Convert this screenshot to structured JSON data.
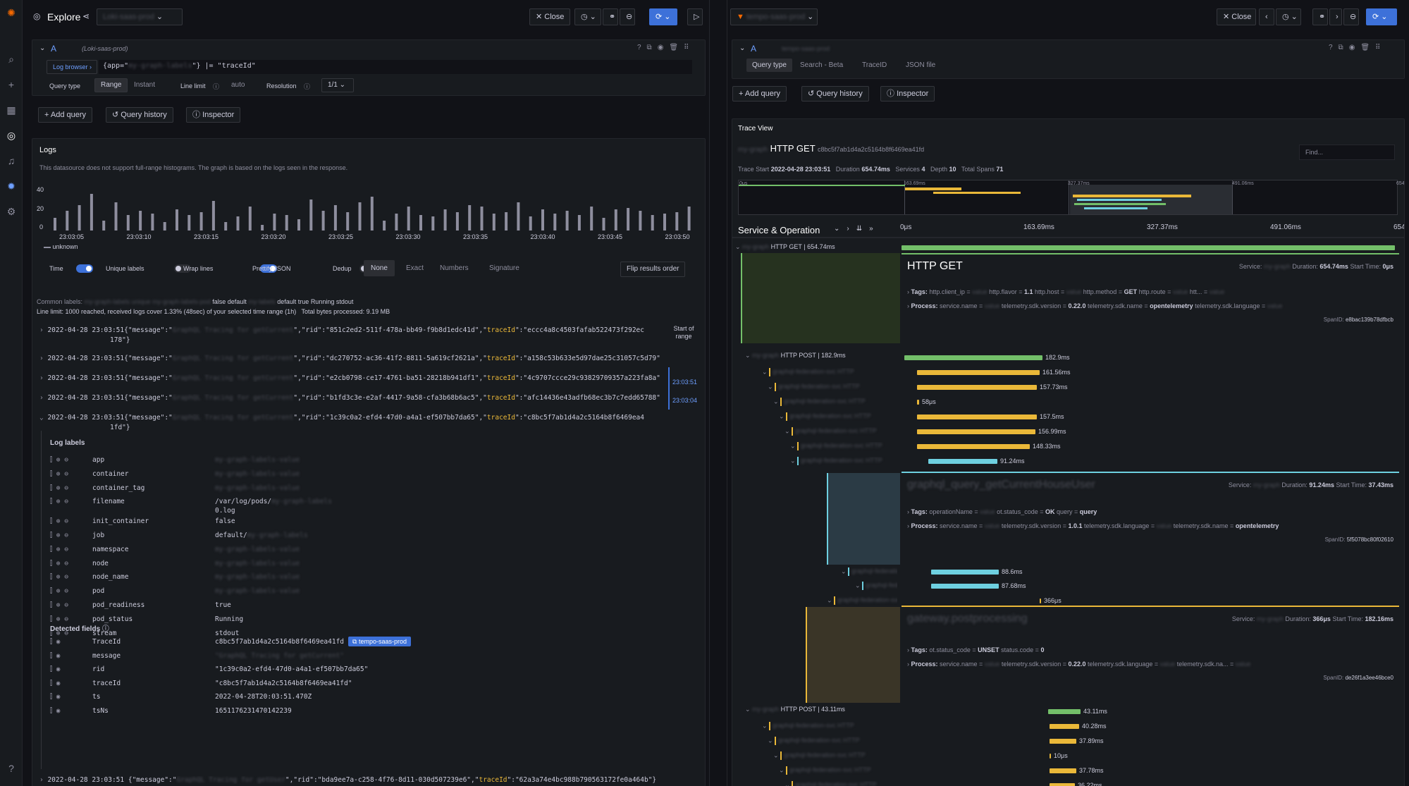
{
  "nav": {
    "title": "Explore",
    "close": "Close"
  },
  "left": {
    "query_letter": "A",
    "datasource": "(Loki-saas-prod)",
    "log_browser": "Log browser",
    "query_prefix": "{app=\"",
    "query_suffix": "\"} |= \"traceId\"",
    "query_type_label": "Query type",
    "range": "Range",
    "instant": "Instant",
    "line_limit_label": "Line limit",
    "line_limit_value": "auto",
    "resolution_label": "Resolution",
    "resolution_value": "1/1",
    "add_query": "Add query",
    "query_history": "Query history",
    "inspector": "Inspector",
    "logs_title": "Logs",
    "logs_note": "This datasource does not support full-range histograms. The graph is based on the logs seen in the response.",
    "y_ticks": [
      "40",
      "20",
      "0"
    ],
    "x_ticks": [
      "23:03:05",
      "23:03:10",
      "23:03:15",
      "23:03:20",
      "23:03:25",
      "23:03:30",
      "23:03:35",
      "23:03:40",
      "23:03:45",
      "23:03:50"
    ],
    "legend": "unknown",
    "opt_time": "Time",
    "opt_unique": "Unique labels",
    "opt_wrap": "Wrap lines",
    "opt_pretty": "Prettify JSON",
    "opt_dedup": "Dedup",
    "dedup_opts": [
      "None",
      "Exact",
      "Numbers",
      "Signature"
    ],
    "flip": "Flip results order",
    "common_labels_key": "Common labels:",
    "common_labels_val": "false default",
    "common_labels_val2": "default true Running stdout",
    "line_limit_note": "Line limit: 1000 reached, received logs cover 1.33% (48sec) of your selected time range (1h)",
    "bytes_note": "Total bytes processed: 9.19 MB",
    "lines": [
      {
        "t": "2022-04-28 23:03:51",
        "a": "{\"message\":\"",
        "b": "\",\"rid\":\"851c2ed2-511f-478a-bb49-f9b8d1edc41d\",\"",
        "k": "traceId",
        "c": "\":\"eccc4a8c4503fafab522473f292ec",
        "d": "178\"}"
      },
      {
        "t": "2022-04-28 23:03:51",
        "a": "{\"message\":\"",
        "b": "\",\"rid\":\"dc270752-ac36-41f2-8811-5a619cf2621a\",\"",
        "k": "traceId",
        "c": "\":\"a158c53b633e5d97dae25c31057c5d79\"}",
        "d": ""
      },
      {
        "t": "2022-04-28 23:03:51",
        "a": "{\"message\":\"",
        "b": "\",\"rid\":\"e2cb0798-ce17-4761-ba51-28218b941df1\",\"",
        "k": "traceId",
        "c": "\":\"4c9707ccce29c93829709357a223fa8a\"}",
        "d": ""
      },
      {
        "t": "2022-04-28 23:03:51",
        "a": "{\"message\":\"",
        "b": "\",\"rid\":\"b1fd3c3e-e2af-4417-9a58-cfa3b68b6ac5\",\"",
        "k": "traceId",
        "c": "\":\"afc14436e43adfb68ec3b7c7edd65788\"}",
        "d": ""
      },
      {
        "t": "2022-04-28 23:03:51",
        "a": "{\"message\":\"",
        "b": "\",\"rid\":\"1c39c0a2-efd4-47d0-a4a1-ef507bb7da65\",\"",
        "k": "traceId",
        "c": "\":\"c8bc5f7ab1d4a2c5164b8f6469ea4",
        "d": "1fd\"}"
      }
    ],
    "last_line": {
      "t": "2022-04-28 23:03:51",
      "a": "{\"message\":\"",
      "b": "\",\"rid\":\"bda9ee7a-c258-4f76-8d11-030d507239e6\",\"",
      "k": "traceId",
      "c": "\":\"62a3a74e4bc988b790563172fe0a464b\"}"
    },
    "start_of_range": "Start of range",
    "range_top": "23:03:51",
    "range_bot": "23:03:04",
    "log_labels_title": "Log labels",
    "labels": [
      {
        "k": "app",
        "v": ""
      },
      {
        "k": "container",
        "v": ""
      },
      {
        "k": "container_tag",
        "v": ""
      },
      {
        "k": "filename",
        "v": "/var/log/pods/"
      },
      {
        "k": "init_container",
        "v": "false"
      },
      {
        "k": "job",
        "v": "default/"
      },
      {
        "k": "namespace",
        "v": ""
      },
      {
        "k": "node",
        "v": ""
      },
      {
        "k": "node_name",
        "v": ""
      },
      {
        "k": "pod",
        "v": ""
      },
      {
        "k": "pod_readiness",
        "v": "true"
      },
      {
        "k": "pod_status",
        "v": "Running"
      },
      {
        "k": "stream",
        "v": "stdout"
      }
    ],
    "filename_tail": "0.log",
    "detected_title": "Detected fields",
    "fields": [
      {
        "k": "TraceId",
        "v": "c8bc5f7ab1d4a2c5164b8f6469ea41fd"
      },
      {
        "k": "message",
        "v": ""
      },
      {
        "k": "rid",
        "v": "\"1c39c0a2-efd4-47d0-a4a1-ef507bb7da65\""
      },
      {
        "k": "traceId",
        "v": "\"c8bc5f7ab1d4a2c5164b8f6469ea41fd\""
      },
      {
        "k": "ts",
        "v": "2022-04-28T20:03:51.470Z"
      },
      {
        "k": "tsNs",
        "v": "1651176231470142239"
      }
    ],
    "tempo_link": "tempo-saas-prod"
  },
  "right": {
    "query_letter": "A",
    "tabs": [
      "Query type",
      "Search - Beta",
      "TraceID",
      "JSON file"
    ],
    "add_query": "Add query",
    "query_history": "Query history",
    "inspector": "Inspector",
    "trace_view": "Trace View",
    "trace_title": "HTTP GET",
    "trace_id": "c8bc5f7ab1d4a2c5164b8f6469ea41fd",
    "find_placeholder": "Find...",
    "trace_start_label": "Trace Start",
    "trace_start": "2022-04-28 23:03:51",
    "duration_label": "Duration",
    "duration": "654.74ms",
    "services_label": "Services",
    "services": "4",
    "depth_label": "Depth",
    "depth": "10",
    "spans_label": "Total Spans",
    "spans": "71",
    "mini_ticks": [
      "0μs",
      "163.69ms",
      "327.37ms",
      "491.06ms",
      "654.74ms"
    ],
    "svc_op": "Service & Operation",
    "ticks": [
      "0μs",
      "163.69ms",
      "327.37ms",
      "491.06ms",
      "654.74ms"
    ],
    "root_span": "HTTP GET | 654.74ms",
    "d1": {
      "title": "HTTP GET",
      "service_label": "Service:",
      "duration_label": "Duration:",
      "duration": "654.74ms",
      "start_label": "Start Time:",
      "start": "0μs",
      "tags_label": "Tags:",
      "tags": [
        {
          "k": "http.client_ip",
          "v": ""
        },
        {
          "k": "http.flavor",
          "v": "1.1"
        },
        {
          "k": "http.host",
          "v": ""
        },
        {
          "k": "http.method",
          "v": "GET"
        },
        {
          "k": "http.route",
          "v": ""
        },
        {
          "k": "htt...",
          "v": ""
        }
      ],
      "process_label": "Process:",
      "process": [
        {
          "k": "service.name",
          "v": ""
        },
        {
          "k": "telemetry.sdk.version",
          "v": "0.22.0"
        },
        {
          "k": "telemetry.sdk.name",
          "v": "opentelemetry"
        },
        {
          "k": "telemetry.sdk.language",
          "v": ""
        }
      ],
      "span_id_label": "SpanID:",
      "span_id": "e8bac139b78dfbcb"
    },
    "span2": "HTTP POST | 182.9ms",
    "bars1": [
      {
        "lbl": "182.9ms",
        "c": "#73bf69"
      },
      {
        "lbl": "161.56ms",
        "c": "#eab839"
      },
      {
        "lbl": "157.73ms",
        "c": "#eab839"
      },
      {
        "lbl": "58μs",
        "c": "#eab839"
      },
      {
        "lbl": "157.5ms",
        "c": "#eab839"
      },
      {
        "lbl": "156.99ms",
        "c": "#eab839"
      },
      {
        "lbl": "148.33ms",
        "c": "#eab839"
      },
      {
        "lbl": "91.24ms",
        "c": "#6ed0e0"
      }
    ],
    "d2": {
      "service_label": "Service:",
      "duration_label": "Duration:",
      "duration": "91.24ms",
      "start_label": "Start Time:",
      "start": "37.43ms",
      "tags_label": "Tags:",
      "tags": [
        {
          "k": "operationName",
          "v": ""
        },
        {
          "k": "ot.status_code",
          "v": "OK"
        },
        {
          "k": "query",
          "v": "query"
        }
      ],
      "process_label": "Process:",
      "process": [
        {
          "k": "service.name",
          "v": ""
        },
        {
          "k": "telemetry.sdk.version",
          "v": "1.0.1"
        },
        {
          "k": "telemetry.sdk.language",
          "v": ""
        },
        {
          "k": "telemetry.sdk.name",
          "v": "opentelemetry"
        }
      ],
      "span_id_label": "SpanID:",
      "span_id": "5f5078bc80f02610"
    },
    "bars2": [
      {
        "lbl": "88.6ms"
      },
      {
        "lbl": "87.68ms"
      },
      {
        "lbl": "366μs"
      }
    ],
    "d3": {
      "service_label": "Service:",
      "duration_label": "Duration:",
      "duration": "366μs",
      "start_label": "Start Time:",
      "start": "182.16ms",
      "tags_label": "Tags:",
      "tags": [
        {
          "k": "ot.status_code",
          "v": "UNSET"
        },
        {
          "k": "status.code",
          "v": "0"
        }
      ],
      "process_label": "Process:",
      "process": [
        {
          "k": "service.name",
          "v": ""
        },
        {
          "k": "telemetry.sdk.version",
          "v": "0.22.0"
        },
        {
          "k": "telemetry.sdk.language",
          "v": ""
        },
        {
          "k": "telemetry.sdk.na...",
          "v": ""
        }
      ],
      "span_id_label": "SpanID:",
      "span_id": "de26f1a3ee46bce0"
    },
    "span3": "HTTP POST | 43.11ms",
    "bars3": [
      {
        "lbl": "43.11ms",
        "c": "#73bf69"
      },
      {
        "lbl": "40.28ms",
        "c": "#eab839"
      },
      {
        "lbl": "37.89ms",
        "c": "#eab839"
      },
      {
        "lbl": "10μs",
        "c": "#eab839"
      },
      {
        "lbl": "37.78ms",
        "c": "#eab839"
      },
      {
        "lbl": "36.22ms",
        "c": "#eab839"
      }
    ],
    "close": "Close"
  }
}
